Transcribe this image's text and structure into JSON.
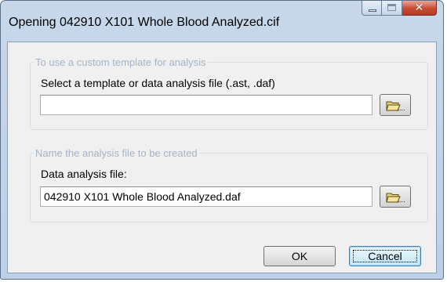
{
  "window": {
    "title": "Opening 042910 X101 Whole Blood Analyzed.cif"
  },
  "caption_buttons": {
    "minimize_icon": "minimize-icon",
    "maximize_icon": "maximize-icon",
    "close_icon": "close-icon",
    "close_glyph": "✕"
  },
  "template_group": {
    "legend": "To use a custom template for analysis",
    "label": "Select a template or data analysis file (.ast, .daf)",
    "value": "",
    "browse_icon": "folder-open-icon",
    "browse_label": "..."
  },
  "analysis_group": {
    "legend": "Name the analysis file to be created",
    "label": "Data analysis file:",
    "value": "042910 X101 Whole Blood Analyzed.daf",
    "browse_icon": "folder-open-icon",
    "browse_label": "..."
  },
  "buttons": {
    "ok": "OK",
    "cancel": "Cancel"
  },
  "colors": {
    "title_bar": "#c8d8ea",
    "close_button": "#c74a32",
    "disabled_legend": "#a6b3c2",
    "dialog_face": "#f0f0f0"
  }
}
